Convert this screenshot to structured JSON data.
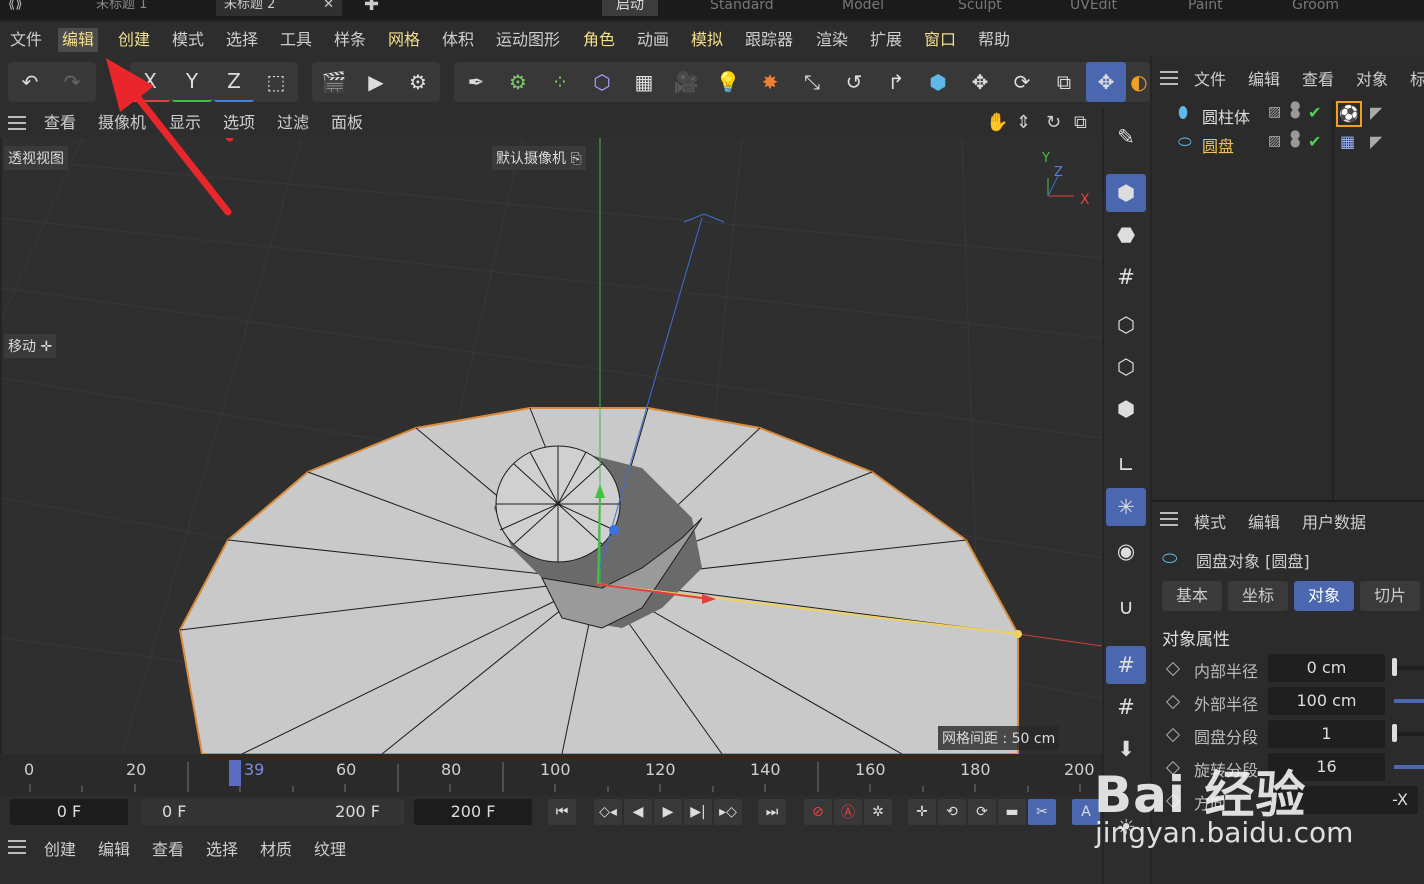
{
  "doc_tabs": [
    {
      "label": "未标题 1"
    },
    {
      "label": "未标题 2"
    }
  ],
  "layouts": [
    "启动",
    "Standard",
    "Model",
    "Sculpt",
    "UVEdit",
    "Paint",
    "Groom"
  ],
  "menu": [
    "文件",
    "编辑",
    "创建",
    "模式",
    "选择",
    "工具",
    "样条",
    "网格",
    "体积",
    "运动图形",
    "角色",
    "动画",
    "模拟",
    "跟踪器",
    "渲染",
    "扩展",
    "窗口",
    "帮助"
  ],
  "toolbar": {
    "axis_x": "X",
    "axis_y": "Y",
    "axis_z": "Z"
  },
  "viewport_menu": [
    "查看",
    "摄像机",
    "显示",
    "选项",
    "过滤",
    "面板"
  ],
  "viewport": {
    "view_name": "透视视图",
    "camera_label": "默认摄像机",
    "mode_label": "移动",
    "grid_label": "网格间距 : 50 cm",
    "axis_y": "Y",
    "axis_z": "Z",
    "axis_x": "X"
  },
  "object_manager": {
    "menu": [
      "文件",
      "编辑",
      "查看",
      "对象",
      "标"
    ],
    "objects": [
      {
        "name": "圆柱体"
      },
      {
        "name": "圆盘"
      }
    ]
  },
  "attributes": {
    "menu": [
      "模式",
      "编辑",
      "用户数据"
    ],
    "title": "圆盘对象 [圆盘]",
    "tabs": [
      "基本",
      "坐标",
      "对象",
      "切片"
    ],
    "section": "对象属性",
    "props": [
      {
        "label": "内部半径",
        "value": "0 cm",
        "slider": 0.0
      },
      {
        "label": "外部半径",
        "value": "100 cm",
        "slider": 1.0
      },
      {
        "label": "圆盘分段",
        "value": "1",
        "slider": 0.0
      },
      {
        "label": "旋转分段",
        "value": "16",
        "slider": 1.0
      },
      {
        "label": "方向",
        "value": "-X",
        "slider": null
      }
    ]
  },
  "timeline": {
    "ticks": [
      "0",
      "20",
      "39",
      "60",
      "80",
      "100",
      "120",
      "140",
      "160",
      "180",
      "200"
    ],
    "current_frame": "39"
  },
  "transport": {
    "current": "0 F",
    "range_start": "0 F",
    "range_end": "200 F",
    "max": "200 F"
  },
  "bottom_menu": [
    "创建",
    "编辑",
    "查看",
    "选择",
    "材质",
    "纹理"
  ],
  "watermark": {
    "brand": "Bai 经验",
    "url": "jingyan.baidu.com"
  },
  "colors": {
    "accent": "#4a67b0",
    "highlight": "#f3df8c",
    "object_name": "#f0c060",
    "arrow": "#e8262b"
  }
}
